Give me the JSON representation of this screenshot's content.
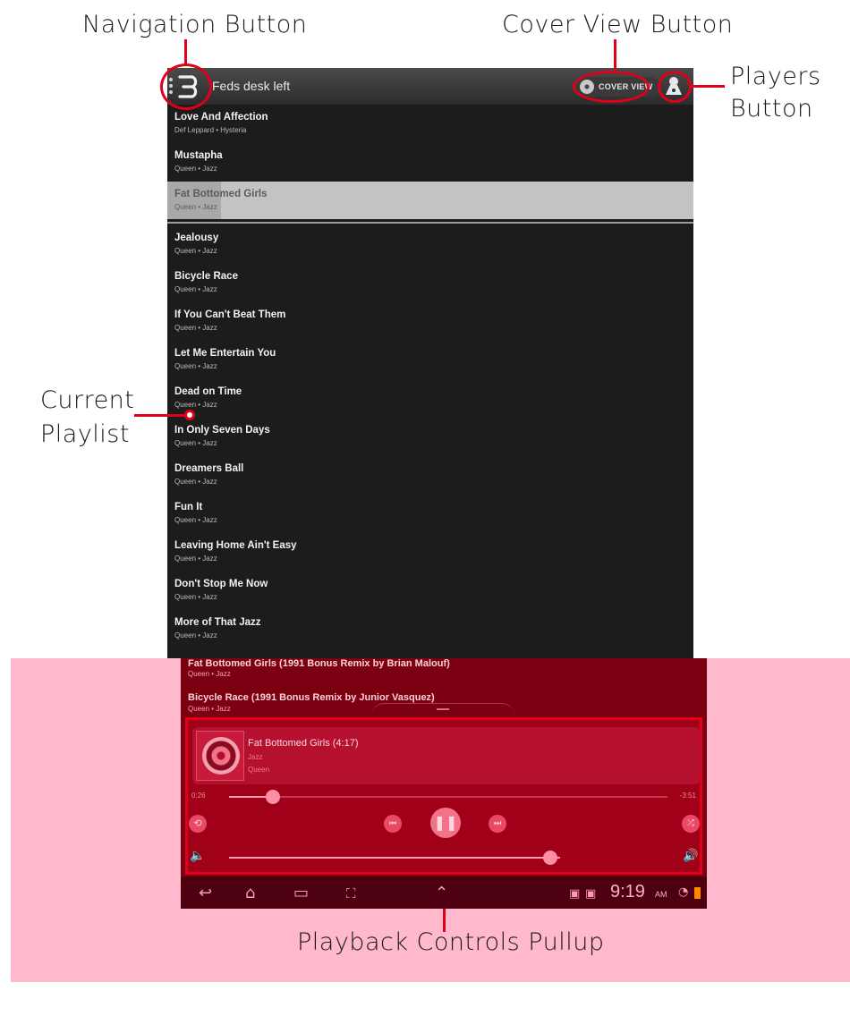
{
  "callouts": {
    "navigation": "Navigation Button",
    "cover_view": "Cover View Button",
    "players_line1": "Players",
    "players_line2": "Button",
    "playlist_line1": "Current",
    "playlist_line2": "Playlist",
    "playback": "Playback Controls Pullup"
  },
  "header": {
    "zone_name": "Feds desk left",
    "cover_view_label": "COVER VIEW"
  },
  "playlist": [
    {
      "title": "Love And Affection",
      "subtitle": "Def Leppard • Hysteria"
    },
    {
      "title": "Mustapha",
      "subtitle": "Queen • Jazz"
    },
    {
      "title": "Fat Bottomed Girls",
      "subtitle": "Queen • Jazz",
      "current": true
    },
    {
      "title": "Jealousy",
      "subtitle": "Queen • Jazz"
    },
    {
      "title": "Bicycle Race",
      "subtitle": "Queen • Jazz"
    },
    {
      "title": "If You Can't Beat Them",
      "subtitle": "Queen • Jazz"
    },
    {
      "title": "Let Me Entertain You",
      "subtitle": "Queen • Jazz"
    },
    {
      "title": "Dead on Time",
      "subtitle": "Queen • Jazz"
    },
    {
      "title": "In Only Seven Days",
      "subtitle": "Queen • Jazz"
    },
    {
      "title": "Dreamers Ball",
      "subtitle": "Queen • Jazz"
    },
    {
      "title": "Fun It",
      "subtitle": "Queen • Jazz"
    },
    {
      "title": "Leaving Home Ain't Easy",
      "subtitle": "Queen • Jazz"
    },
    {
      "title": "Don't Stop Me Now",
      "subtitle": "Queen • Jazz"
    },
    {
      "title": "More of That Jazz",
      "subtitle": "Queen • Jazz"
    }
  ],
  "pullup": {
    "partial_title": "Fat Bottomed Girls (1991 Bonus Remix by Brian Malouf)",
    "partial_subtitle": "Queen • Jazz",
    "next_title": "Bicycle Race (1991 Bonus Remix by Junior Vasquez)",
    "next_subtitle": "Queen • Jazz",
    "now_playing": {
      "title": "Fat Bottomed Girls (4:17)",
      "album": "Jazz",
      "artist": "Queen",
      "elapsed": "0:26",
      "remaining": "-3:51",
      "progress_fraction": 0.1,
      "volume_fraction": 0.97
    }
  },
  "system": {
    "time": "9:19",
    "ampm": "AM"
  },
  "colors": {
    "callout": "#e0001a",
    "pink_panel": "#ffb8cc",
    "controls_bg": "#a00018"
  }
}
